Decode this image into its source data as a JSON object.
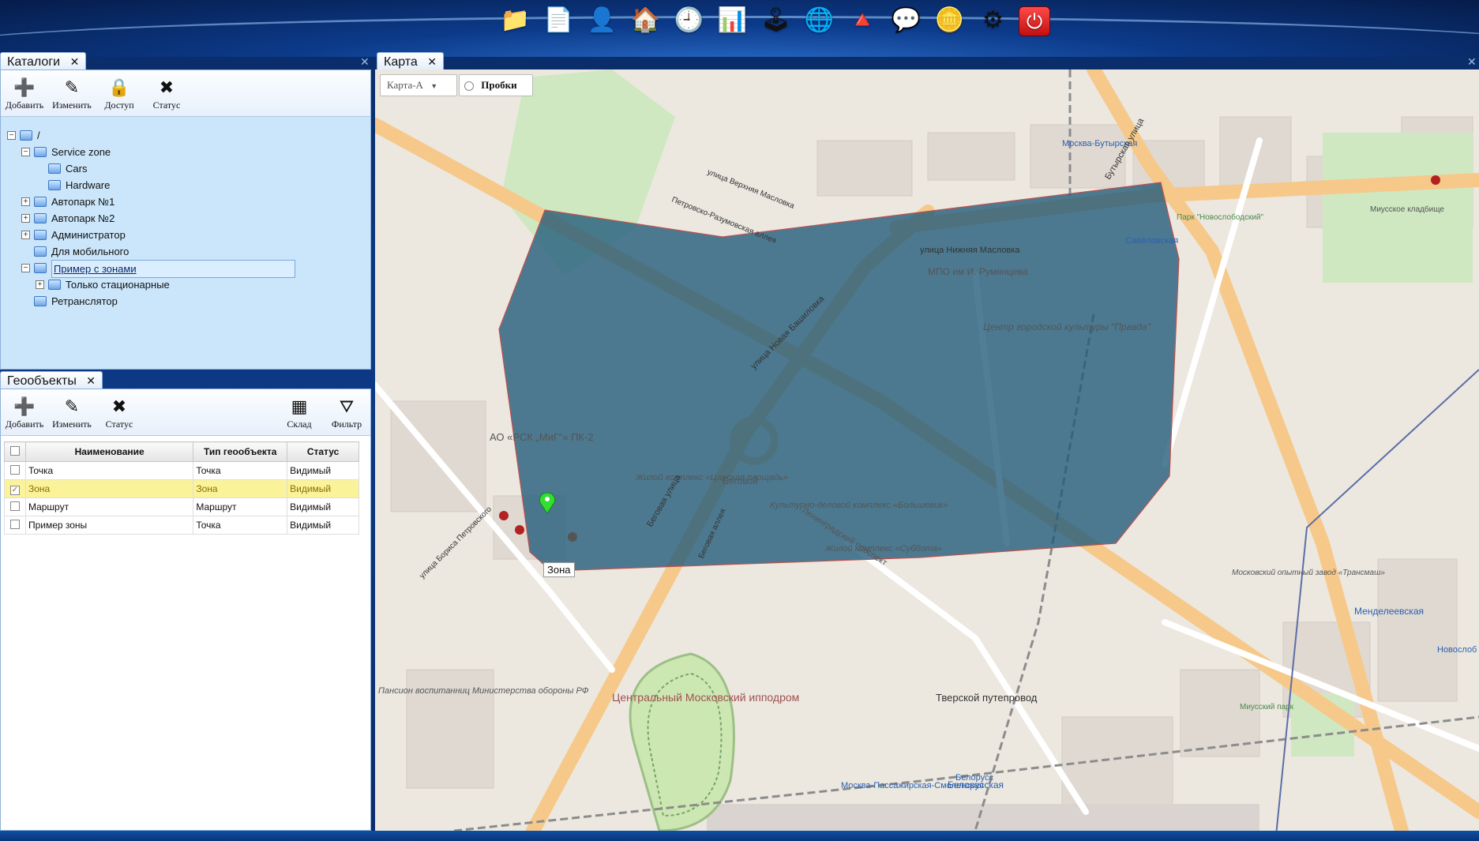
{
  "toolbar": {
    "icons": [
      {
        "name": "catalogs-icon",
        "glyph": "📁"
      },
      {
        "name": "documents-icon",
        "glyph": "📄"
      },
      {
        "name": "contacts-icon",
        "glyph": "👤"
      },
      {
        "name": "objects-icon",
        "glyph": "🏠"
      },
      {
        "name": "history-icon",
        "glyph": "🕘"
      },
      {
        "name": "reports-icon",
        "glyph": "📊"
      },
      {
        "name": "control-icon",
        "glyph": "🕹"
      },
      {
        "name": "globe-icon",
        "glyph": "🌐"
      },
      {
        "name": "geoobjects-icon",
        "glyph": "🔺"
      },
      {
        "name": "messages-icon",
        "glyph": "💬"
      },
      {
        "name": "billing-icon",
        "glyph": "🪙"
      },
      {
        "name": "settings-icon",
        "glyph": "⚙"
      },
      {
        "name": "power-icon",
        "glyph": "⏻"
      }
    ]
  },
  "catalogs": {
    "tab_label": "Каталоги",
    "tab_close": "✕",
    "panel_close": "✕",
    "buttons": [
      {
        "label": "Добавить",
        "glyph": "➕"
      },
      {
        "label": "Изменить",
        "glyph": "✎"
      },
      {
        "label": "Доступ",
        "glyph": "🔒"
      },
      {
        "label": "Статус",
        "glyph": "✖"
      }
    ],
    "tree": [
      {
        "label": "/",
        "pm": "−"
      },
      {
        "label": "Service zone",
        "pm": "−"
      },
      {
        "label": "Cars",
        "pm": ""
      },
      {
        "label": "Hardware",
        "pm": ""
      },
      {
        "label": "Автопарк №1",
        "pm": "+"
      },
      {
        "label": "Автопарк №2",
        "pm": "+"
      },
      {
        "label": "Администратор",
        "pm": "+"
      },
      {
        "label": "Для мобильного",
        "pm": ""
      },
      {
        "label": "Пример с зонами",
        "pm": "−"
      },
      {
        "label": "Только стационарные",
        "pm": "+"
      },
      {
        "label": "Ретранслятор",
        "pm": ""
      }
    ]
  },
  "geoobjects": {
    "tab_label": "Геообъекты",
    "tab_close": "✕",
    "buttons": [
      {
        "label": "Добавить",
        "glyph": "➕"
      },
      {
        "label": "Изменить",
        "glyph": "✎"
      },
      {
        "label": "Статус",
        "glyph": "✖"
      }
    ],
    "buttons_right": [
      {
        "label": "Склад",
        "glyph": "▦"
      },
      {
        "label": "Фильтр",
        "glyph": "⛛"
      }
    ],
    "columns": [
      "Наименование",
      "Тип геообъекта",
      "Статус"
    ],
    "rows": [
      {
        "checked": false,
        "name": "Точка",
        "type": "Точка",
        "status": "Видимый",
        "selected": false
      },
      {
        "checked": true,
        "name": "Зона",
        "type": "Зона",
        "status": "Видимый",
        "selected": true
      },
      {
        "checked": false,
        "name": "Маршрут",
        "type": "Маршрут",
        "status": "Видимый",
        "selected": false
      },
      {
        "checked": false,
        "name": "Пример зоны",
        "type": "Точка",
        "status": "Видимый",
        "selected": false
      }
    ]
  },
  "map": {
    "tab_label": "Карта",
    "tab_close": "✕",
    "panel_close": "✕",
    "map_type": "Карта-А",
    "traffic_label": "Пробки",
    "traffic_checked": false,
    "zone_color": "#1f5a7a",
    "zone_marker_label": "Зона",
    "labels": [
      "Москва-Бутырская",
      "Савёловская",
      "МПО им И. Румянцева",
      "Центр городской культуры \"Правда\"",
      "АО «РСК „МиГ“» ПК-2",
      "Жилой комплекс «Царская площадь»",
      "Беговой",
      "Культурно-деловой комплекс «Большевик»",
      "Жилой комплекс «Суббота»",
      "Центральный Московский ипподром",
      "Тверской путепровод",
      "Белорусская",
      "Москва-Пассажирская-Смоленская",
      "Менделеевская",
      "Новослоб",
      "Миусское кладбище",
      "Парк \"Новослободский\"",
      "Миусский парк",
      "Пансион воспитанниц Министерства обороны РФ",
      "Ленинградский проспект",
      "улица Нижняя Масловка",
      "Бутырская улица",
      "улица Новая Башиловка",
      "Беговая улица",
      "Беговая аллея",
      "Московский опытный завод «Трансмаш»",
      "Белорусс",
      "Петровско-Разумовская аллея",
      "улица Верхняя Масловка",
      "улица Бориса Петровского"
    ]
  }
}
